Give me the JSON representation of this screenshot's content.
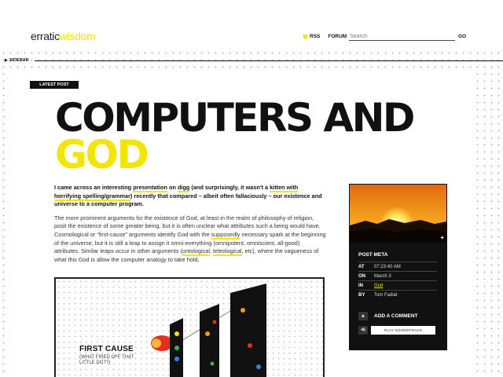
{
  "header": {
    "logo_part1": "erratic",
    "logo_part2": "wisdom",
    "nav": [
      "RSS",
      "FORUM"
    ],
    "search_placeholder": "Search",
    "go_label": "GO"
  },
  "sidebar_label": "SIDEBAR",
  "post": {
    "badge": "LATEST POST",
    "title_line1": "COMPUTERS AND",
    "title_line2": "GOD",
    "lead": {
      "t1": "I came across an interesting ",
      "l1": "presentation",
      "t2": " on ",
      "l2": "digg",
      "t3": " (and surprisingly, it wasn't a ",
      "l3": "kitten with horrifying spelling/grammar",
      "t4": ") recently that compared – albeit often fallaciously – our existence and universe to a computer program."
    },
    "body": {
      "t1": "The more prominent arguments for the existence of God, at least in the realm of philosophy of religion, posit the existence of some greater being, but it is often unclear what attributes such a being would have. Cosmological or “first-cause” arguments identify God with the ",
      "l1": "supposedly",
      "t2": " necessary spark at the beginning of the universe, but it is still a leap to assign it omni-everything (omnipotent, omniscient, all-good) attributes. Similar leaps occur in other arguments (",
      "l2": "ontological",
      "t3": ", ",
      "l3": "teleological",
      "t4": ", etc), where the vagueness of what this God is allow the computer analogy to take hold."
    },
    "figure": {
      "title": "FIRST CAUSE",
      "subtitle": "(WHAT FIRED OFF THAT LITTLE DOT?)"
    }
  },
  "post_meta": {
    "heading": "POST META",
    "rows": [
      {
        "key": "AT",
        "value": "07:23:40 AM"
      },
      {
        "key": "ON",
        "value": "March 3"
      },
      {
        "key": "IN",
        "value": "God"
      },
      {
        "key": "BY",
        "value": "Tom Fadial"
      }
    ],
    "add_comment": "ADD A COMMENT",
    "share_label": "PLAY SOUNDTRACK"
  },
  "colors": {
    "accent": "#f2e600",
    "dark": "#111111"
  }
}
